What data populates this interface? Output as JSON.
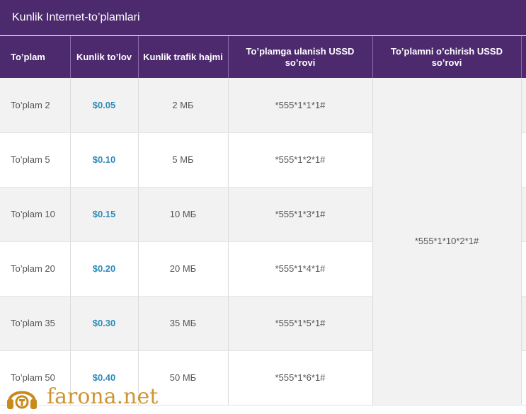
{
  "title": "Kunlik Internet-to’plamlari",
  "table": {
    "headers": [
      "To’plam",
      "Kunlik to’lov",
      "Kunlik trafik hajmi",
      "To’plamga ulanish USSD so’rovi",
      "To’plamni o’chirish USSD so’rovi"
    ],
    "rows": [
      {
        "name": "To’plam 2",
        "price": "$0.05",
        "volume": "2 МБ",
        "connect": "*555*1*1*1#"
      },
      {
        "name": "To’plam 5",
        "price": "$0.10",
        "volume": "5 МБ",
        "connect": "*555*1*2*1#"
      },
      {
        "name": "To’plam 10",
        "price": "$0.15",
        "volume": "10 МБ",
        "connect": "*555*1*3*1#"
      },
      {
        "name": "To’plam 20",
        "price": "$0.20",
        "volume": "20 МБ",
        "connect": "*555*1*4*1#"
      },
      {
        "name": "To’plam 35",
        "price": "$0.30",
        "volume": "35 МБ",
        "connect": "*555*1*5*1#"
      },
      {
        "name": "To’plam 50",
        "price": "$0.40",
        "volume": "50 МБ",
        "connect": "*555*1*6*1#"
      }
    ],
    "disconnect": "*555*1*10*2*1#"
  },
  "watermark": {
    "text": "farona.net",
    "icon": "headphones-logo-icon"
  },
  "colors": {
    "header_bg": "#4d2a6e",
    "price": "#2e8bb8",
    "watermark": "#c98a1c"
  }
}
